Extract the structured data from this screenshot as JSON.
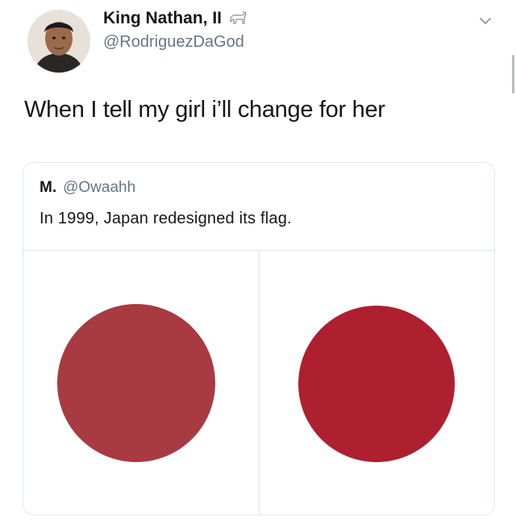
{
  "tweet": {
    "display_name": "King Nathan, II",
    "handle": "@RodriguezDaGod",
    "text": "When I tell my girl i’ll change for her",
    "emoji_icon": "goat-icon",
    "menu_icon": "chevron-down-icon"
  },
  "quoted_tweet": {
    "display_name": "M.",
    "handle": "@Owaahh",
    "text": "In 1999, Japan redesigned its flag."
  },
  "media": {
    "left_circle_color": "#a83a42",
    "right_circle_color": "#ae1f2f"
  },
  "colors": {
    "text_primary": "#14171a",
    "text_secondary": "#657786",
    "border": "#e1e8ed"
  }
}
